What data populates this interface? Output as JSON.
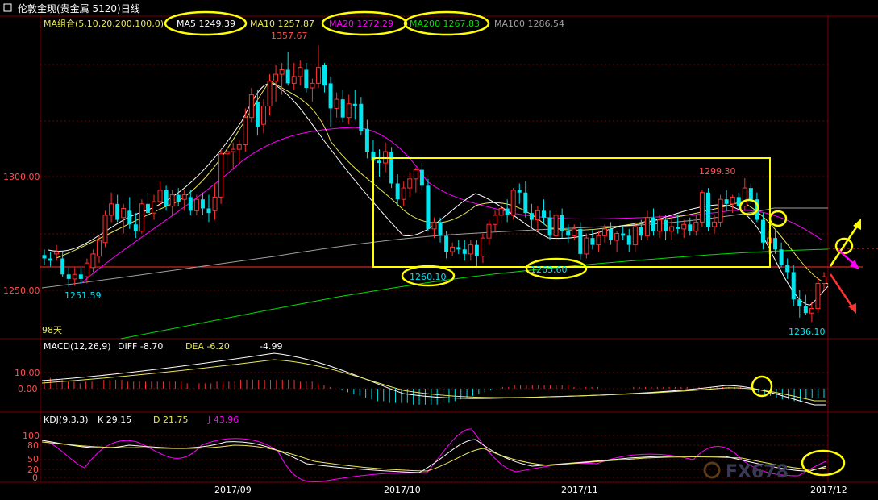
{
  "title": "伦敦金现(贵金属 5120)日线",
  "icons": {
    "menu": "square-menu-icon"
  },
  "colors": {
    "up": "#ff3030",
    "down": "#00e5ee",
    "bg": "#000000",
    "grid": "#7a0000",
    "ma5": "#ffffff",
    "ma10": "#e8e85a",
    "ma20": "#ff00ff",
    "ma200": "#00e000",
    "ma100": "#a0a0a0",
    "highlight": "#ffff00",
    "arrow_up": "#ffff00",
    "arrow_down": "#ff3030",
    "arrow_mid": "#ff00ff"
  },
  "legend": {
    "group": "MA组合(5,10,20,200,100,0)",
    "ma5": "MA5 1249.39",
    "ma10": "MA10 1257.87",
    "ma20": "MA20 1272.29",
    "ma200": "MA200 1267.83",
    "ma100": "MA100 1286.54"
  },
  "price_axis": {
    "ticks": [
      "1300.00",
      "1250.00"
    ]
  },
  "annotations": {
    "high_label": "1357.67",
    "low_start": "1251.59",
    "peak_oct": "1299.30",
    "low_oct": "1260.10",
    "low_nov": "1263.60",
    "low_dec": "1236.10",
    "days": "98天"
  },
  "macd": {
    "label": "MACD(12,26,9)",
    "diff": "DIFF  -8.70",
    "dea": "DEA  -6.20",
    "macd": "-4.99",
    "ticks": [
      "10.00",
      "0.00"
    ]
  },
  "kdj": {
    "label": "KDJ(9,3,3)",
    "k": "K  29.15",
    "d": "D  21.75",
    "j": "J  43.96",
    "ticks": [
      "100",
      "80",
      "50",
      "20",
      "0"
    ]
  },
  "x_axis": {
    "labels": [
      "2017/09",
      "2017/10",
      "2017/11",
      "2017/12"
    ]
  },
  "watermark": "FX678",
  "chart_data": {
    "type": "candlestick",
    "title": "伦敦金现(贵金属 5120)日线",
    "price_range": [
      1230,
      1370
    ],
    "grid": true,
    "candles": [
      {
        "o": 1265.5,
        "h": 1268,
        "l": 1261,
        "c": 1264
      },
      {
        "o": 1264,
        "h": 1267,
        "l": 1260.5,
        "c": 1263
      },
      {
        "o": 1266,
        "h": 1270,
        "l": 1263,
        "c": 1267
      },
      {
        "o": 1264,
        "h": 1267,
        "l": 1256,
        "c": 1257
      },
      {
        "o": 1257,
        "h": 1260,
        "l": 1251.6,
        "c": 1255
      },
      {
        "o": 1255,
        "h": 1260,
        "l": 1252,
        "c": 1257
      },
      {
        "o": 1257,
        "h": 1260,
        "l": 1253,
        "c": 1255
      },
      {
        "o": 1256,
        "h": 1264,
        "l": 1253,
        "c": 1262
      },
      {
        "o": 1260,
        "h": 1268,
        "l": 1258,
        "c": 1266
      },
      {
        "o": 1265,
        "h": 1274,
        "l": 1262,
        "c": 1272
      },
      {
        "o": 1271,
        "h": 1285,
        "l": 1269,
        "c": 1283
      },
      {
        "o": 1283,
        "h": 1293,
        "l": 1280,
        "c": 1288
      },
      {
        "o": 1288,
        "h": 1292,
        "l": 1280,
        "c": 1281
      },
      {
        "o": 1282,
        "h": 1288,
        "l": 1275,
        "c": 1286
      },
      {
        "o": 1285,
        "h": 1291,
        "l": 1277,
        "c": 1279
      },
      {
        "o": 1279,
        "h": 1284,
        "l": 1273,
        "c": 1276
      },
      {
        "o": 1276,
        "h": 1290,
        "l": 1275,
        "c": 1288
      },
      {
        "o": 1288,
        "h": 1293,
        "l": 1282,
        "c": 1284
      },
      {
        "o": 1284,
        "h": 1292,
        "l": 1281,
        "c": 1289
      },
      {
        "o": 1289,
        "h": 1298,
        "l": 1287,
        "c": 1294
      },
      {
        "o": 1294,
        "h": 1296,
        "l": 1285,
        "c": 1287
      },
      {
        "o": 1287,
        "h": 1294,
        "l": 1283,
        "c": 1292
      },
      {
        "o": 1292,
        "h": 1295,
        "l": 1287,
        "c": 1289
      },
      {
        "o": 1290,
        "h": 1294,
        "l": 1285,
        "c": 1292
      },
      {
        "o": 1291,
        "h": 1294,
        "l": 1283,
        "c": 1285
      },
      {
        "o": 1285,
        "h": 1292,
        "l": 1283,
        "c": 1290
      },
      {
        "o": 1290,
        "h": 1293,
        "l": 1283,
        "c": 1286
      },
      {
        "o": 1286,
        "h": 1292,
        "l": 1280,
        "c": 1284
      },
      {
        "o": 1285,
        "h": 1297,
        "l": 1281,
        "c": 1291
      },
      {
        "o": 1291,
        "h": 1312,
        "l": 1288,
        "c": 1310
      },
      {
        "o": 1310,
        "h": 1313,
        "l": 1302,
        "c": 1311
      },
      {
        "o": 1311,
        "h": 1315,
        "l": 1303,
        "c": 1312
      },
      {
        "o": 1312,
        "h": 1316,
        "l": 1306,
        "c": 1314
      },
      {
        "o": 1314,
        "h": 1330,
        "l": 1311,
        "c": 1326
      },
      {
        "o": 1326,
        "h": 1339,
        "l": 1324,
        "c": 1336
      },
      {
        "o": 1333,
        "h": 1338,
        "l": 1318,
        "c": 1322
      },
      {
        "o": 1323,
        "h": 1334,
        "l": 1319,
        "c": 1331
      },
      {
        "o": 1331,
        "h": 1345,
        "l": 1327,
        "c": 1342
      },
      {
        "o": 1342,
        "h": 1349,
        "l": 1333,
        "c": 1345
      },
      {
        "o": 1345,
        "h": 1350,
        "l": 1336,
        "c": 1347
      },
      {
        "o": 1347,
        "h": 1355,
        "l": 1340,
        "c": 1341
      },
      {
        "o": 1341,
        "h": 1350,
        "l": 1338,
        "c": 1344
      },
      {
        "o": 1344,
        "h": 1351,
        "l": 1340,
        "c": 1348
      },
      {
        "o": 1347,
        "h": 1350,
        "l": 1337,
        "c": 1339
      },
      {
        "o": 1339,
        "h": 1343,
        "l": 1333,
        "c": 1341
      },
      {
        "o": 1341,
        "h": 1357.67,
        "l": 1339,
        "c": 1348
      },
      {
        "o": 1349,
        "h": 1350,
        "l": 1337,
        "c": 1340
      },
      {
        "o": 1341,
        "h": 1344,
        "l": 1322,
        "c": 1330
      },
      {
        "o": 1330,
        "h": 1337,
        "l": 1326,
        "c": 1334
      },
      {
        "o": 1334,
        "h": 1338,
        "l": 1324,
        "c": 1326
      },
      {
        "o": 1326,
        "h": 1336,
        "l": 1323,
        "c": 1332
      },
      {
        "o": 1332,
        "h": 1338,
        "l": 1325,
        "c": 1331
      },
      {
        "o": 1332,
        "h": 1335,
        "l": 1318,
        "c": 1320
      },
      {
        "o": 1321,
        "h": 1325,
        "l": 1308,
        "c": 1311
      },
      {
        "o": 1311,
        "h": 1316,
        "l": 1303,
        "c": 1307
      },
      {
        "o": 1307,
        "h": 1312,
        "l": 1300,
        "c": 1306
      },
      {
        "o": 1306,
        "h": 1315,
        "l": 1302,
        "c": 1311
      },
      {
        "o": 1311,
        "h": 1313,
        "l": 1295,
        "c": 1297
      },
      {
        "o": 1297,
        "h": 1301,
        "l": 1287,
        "c": 1290
      },
      {
        "o": 1290,
        "h": 1298,
        "l": 1287,
        "c": 1295
      },
      {
        "o": 1295,
        "h": 1302,
        "l": 1291,
        "c": 1299
      },
      {
        "o": 1299,
        "h": 1304,
        "l": 1293,
        "c": 1303
      },
      {
        "o": 1303,
        "h": 1306,
        "l": 1294,
        "c": 1296
      },
      {
        "o": 1296,
        "h": 1299,
        "l": 1276,
        "c": 1277
      },
      {
        "o": 1277,
        "h": 1282,
        "l": 1273,
        "c": 1280
      },
      {
        "o": 1280,
        "h": 1282,
        "l": 1271,
        "c": 1274
      },
      {
        "o": 1274,
        "h": 1276,
        "l": 1264,
        "c": 1267
      },
      {
        "o": 1267,
        "h": 1271,
        "l": 1265,
        "c": 1269
      },
      {
        "o": 1269,
        "h": 1272,
        "l": 1266,
        "c": 1268
      },
      {
        "o": 1268,
        "h": 1272,
        "l": 1263,
        "c": 1266
      },
      {
        "o": 1266,
        "h": 1272,
        "l": 1263,
        "c": 1270
      },
      {
        "o": 1270,
        "h": 1272,
        "l": 1260.1,
        "c": 1265
      },
      {
        "o": 1265,
        "h": 1275,
        "l": 1262,
        "c": 1273
      },
      {
        "o": 1273,
        "h": 1281,
        "l": 1270,
        "c": 1279
      },
      {
        "o": 1279,
        "h": 1285,
        "l": 1276,
        "c": 1283
      },
      {
        "o": 1283,
        "h": 1289,
        "l": 1279,
        "c": 1286
      },
      {
        "o": 1286,
        "h": 1290,
        "l": 1280,
        "c": 1283
      },
      {
        "o": 1283,
        "h": 1295,
        "l": 1281,
        "c": 1294
      },
      {
        "o": 1294,
        "h": 1297,
        "l": 1288,
        "c": 1293
      },
      {
        "o": 1293,
        "h": 1298,
        "l": 1282,
        "c": 1284
      },
      {
        "o": 1284,
        "h": 1288,
        "l": 1278,
        "c": 1281
      },
      {
        "o": 1281,
        "h": 1287,
        "l": 1276,
        "c": 1285
      },
      {
        "o": 1285,
        "h": 1290,
        "l": 1279,
        "c": 1282
      },
      {
        "o": 1282,
        "h": 1285,
        "l": 1272,
        "c": 1274
      },
      {
        "o": 1274,
        "h": 1285,
        "l": 1271,
        "c": 1283
      },
      {
        "o": 1283,
        "h": 1286,
        "l": 1273,
        "c": 1276
      },
      {
        "o": 1276,
        "h": 1279,
        "l": 1271,
        "c": 1274
      },
      {
        "o": 1274,
        "h": 1279,
        "l": 1272,
        "c": 1277
      },
      {
        "o": 1277,
        "h": 1280,
        "l": 1263.6,
        "c": 1266
      },
      {
        "o": 1266,
        "h": 1275,
        "l": 1264,
        "c": 1273
      },
      {
        "o": 1273,
        "h": 1277,
        "l": 1268,
        "c": 1270
      },
      {
        "o": 1270,
        "h": 1276,
        "l": 1267,
        "c": 1274
      },
      {
        "o": 1274,
        "h": 1279,
        "l": 1271,
        "c": 1277
      },
      {
        "o": 1277,
        "h": 1280,
        "l": 1270,
        "c": 1272
      },
      {
        "o": 1272,
        "h": 1276,
        "l": 1267,
        "c": 1275
      },
      {
        "o": 1275,
        "h": 1278,
        "l": 1272,
        "c": 1274
      },
      {
        "o": 1274,
        "h": 1277,
        "l": 1267,
        "c": 1270
      },
      {
        "o": 1270,
        "h": 1280,
        "l": 1267,
        "c": 1278
      },
      {
        "o": 1278,
        "h": 1281,
        "l": 1272,
        "c": 1274
      },
      {
        "o": 1274,
        "h": 1285,
        "l": 1272,
        "c": 1282
      },
      {
        "o": 1282,
        "h": 1286,
        "l": 1274,
        "c": 1276
      },
      {
        "o": 1276,
        "h": 1283,
        "l": 1273,
        "c": 1281
      },
      {
        "o": 1281,
        "h": 1283,
        "l": 1272,
        "c": 1276
      },
      {
        "o": 1276,
        "h": 1282,
        "l": 1272,
        "c": 1278
      },
      {
        "o": 1278,
        "h": 1283,
        "l": 1275,
        "c": 1277
      },
      {
        "o": 1277,
        "h": 1281,
        "l": 1273,
        "c": 1279
      },
      {
        "o": 1279,
        "h": 1282,
        "l": 1274,
        "c": 1276
      },
      {
        "o": 1276,
        "h": 1283,
        "l": 1274,
        "c": 1280
      },
      {
        "o": 1280,
        "h": 1294,
        "l": 1278,
        "c": 1293
      },
      {
        "o": 1293,
        "h": 1295,
        "l": 1276,
        "c": 1278
      },
      {
        "o": 1278,
        "h": 1283,
        "l": 1275,
        "c": 1280
      },
      {
        "o": 1280,
        "h": 1292,
        "l": 1278,
        "c": 1290
      },
      {
        "o": 1290,
        "h": 1294,
        "l": 1285,
        "c": 1288
      },
      {
        "o": 1288,
        "h": 1292,
        "l": 1284,
        "c": 1291
      },
      {
        "o": 1291,
        "h": 1293,
        "l": 1286,
        "c": 1287
      },
      {
        "o": 1287,
        "h": 1299.3,
        "l": 1285,
        "c": 1295
      },
      {
        "o": 1295,
        "h": 1297,
        "l": 1288,
        "c": 1290
      },
      {
        "o": 1290,
        "h": 1293,
        "l": 1280,
        "c": 1281
      },
      {
        "o": 1281,
        "h": 1284,
        "l": 1268,
        "c": 1271
      },
      {
        "o": 1271,
        "h": 1276,
        "l": 1266,
        "c": 1273
      },
      {
        "o": 1273,
        "h": 1277,
        "l": 1266,
        "c": 1268
      },
      {
        "o": 1268,
        "h": 1271,
        "l": 1260,
        "c": 1261
      },
      {
        "o": 1261,
        "h": 1264,
        "l": 1255,
        "c": 1258
      },
      {
        "o": 1258,
        "h": 1261,
        "l": 1243,
        "c": 1246
      },
      {
        "o": 1246,
        "h": 1250,
        "l": 1238,
        "c": 1243
      },
      {
        "o": 1243,
        "h": 1248,
        "l": 1239,
        "c": 1240
      },
      {
        "o": 1240,
        "h": 1245,
        "l": 1236.1,
        "c": 1242
      },
      {
        "o": 1242,
        "h": 1255,
        "l": 1240,
        "c": 1253
      },
      {
        "o": 1253,
        "h": 1258,
        "l": 1250,
        "c": 1256
      }
    ],
    "macd_hist": [
      5,
      6,
      6,
      5,
      4,
      4,
      3,
      4,
      4,
      4,
      5,
      5,
      5,
      5,
      4,
      4,
      4,
      4,
      4,
      4,
      4,
      4,
      4,
      4,
      3,
      3,
      3,
      3,
      3,
      4,
      4,
      4,
      4,
      5,
      5,
      5,
      5,
      5,
      5,
      5,
      5,
      5,
      5,
      4,
      4,
      4,
      3,
      2,
      1,
      0,
      -1,
      -2,
      -3,
      -4,
      -5,
      -6,
      -7,
      -7,
      -8,
      -8,
      -8,
      -8,
      -9,
      -9,
      -9,
      -9,
      -9,
      -8,
      -8,
      -7,
      -6,
      -5,
      -4,
      -3,
      -2,
      -1,
      0,
      1,
      1,
      2,
      2,
      2,
      2,
      2,
      2,
      2,
      2,
      2,
      2,
      1,
      1,
      1,
      1,
      1,
      0,
      0,
      0,
      0,
      0,
      1,
      1,
      1,
      1,
      1,
      1,
      1,
      1,
      1,
      1,
      1,
      1,
      1,
      1,
      1,
      1,
      1,
      1,
      1,
      0,
      -1,
      -2,
      -3,
      -4,
      -5,
      -6,
      -6,
      -7,
      -7,
      -6,
      -5,
      -5,
      -5
    ]
  }
}
